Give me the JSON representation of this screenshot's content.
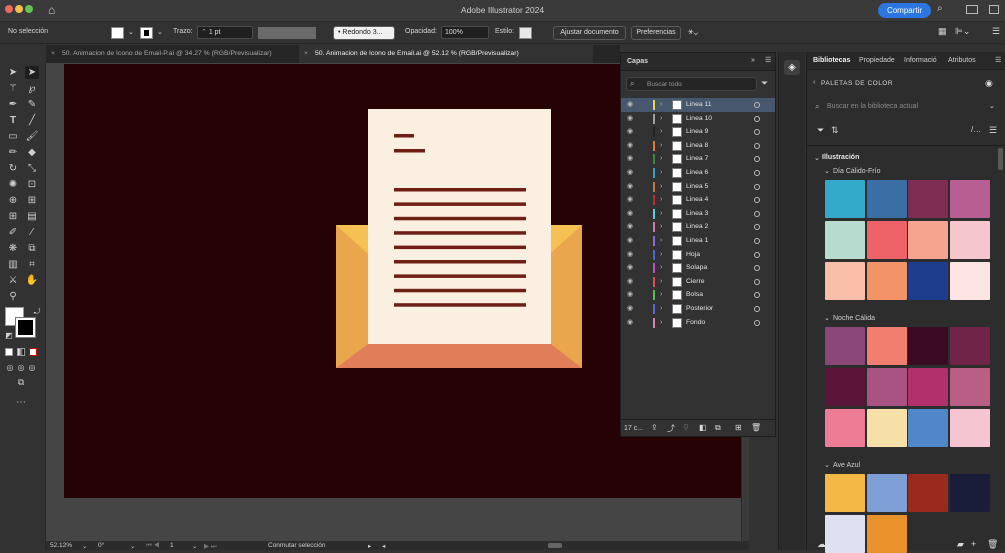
{
  "app": {
    "title": "Adobe Illustrator 2024",
    "share_label": "Compartir"
  },
  "control_bar": {
    "selection": "No selección",
    "stroke_label": "Trazo:",
    "stroke_value": "1 pt",
    "brush_value": "Redondo 3...",
    "opacity_label": "Opacidad:",
    "opacity_value": "100%",
    "style_label": "Estilo:",
    "fit_doc_label": "Ajustar documento",
    "prefs_label": "Preferencias"
  },
  "tabs": [
    {
      "label": "50. Animacion de Icono de Email-P.ai @ 34.27 % (RGB/Previsualizar)",
      "active": false
    },
    {
      "label": "50. Animacion de Icono de Email.ai @ 52.12 % (RGB/Previsualizar)",
      "active": true
    }
  ],
  "status": {
    "zoom": "52.12%",
    "rotation": "0°",
    "artboard": "1",
    "mode": "Conmutar selección"
  },
  "layers_panel": {
    "title": "Capas",
    "search_placeholder": "Buscar todo",
    "count_label": "17 c...",
    "layers": [
      {
        "name": "Linea 11",
        "color": "#e8d44a",
        "selected": true
      },
      {
        "name": "Linea 10",
        "color": "#a0a0a0",
        "selected": false
      },
      {
        "name": "Linea 9",
        "color": "#222222",
        "selected": false
      },
      {
        "name": "Linea 8",
        "color": "#e07a2c",
        "selected": false
      },
      {
        "name": "Linea 7",
        "color": "#3c8a3c",
        "selected": false
      },
      {
        "name": "Linea 6",
        "color": "#3ba0c8",
        "selected": false
      },
      {
        "name": "Linea 5",
        "color": "#c07a4a",
        "selected": false
      },
      {
        "name": "Linea 4",
        "color": "#b83030",
        "selected": false
      },
      {
        "name": "Linea 3",
        "color": "#5ad0e0",
        "selected": false
      },
      {
        "name": "Linea 2",
        "color": "#d878b0",
        "selected": false
      },
      {
        "name": "Linea 1",
        "color": "#8a6ad8",
        "selected": false
      },
      {
        "name": "Hoja",
        "color": "#4a6ad8",
        "selected": false
      },
      {
        "name": "Solapa",
        "color": "#c050c0",
        "selected": false
      },
      {
        "name": "Cierre",
        "color": "#e05050",
        "selected": false
      },
      {
        "name": "Bolsa",
        "color": "#50c050",
        "selected": false
      },
      {
        "name": "Posterior",
        "color": "#5a6ad8",
        "selected": false
      },
      {
        "name": "Fondo",
        "color": "#d880b0",
        "selected": false
      }
    ]
  },
  "libraries": {
    "tabs": [
      "Bibliotecas",
      "Propiedade",
      "Informació",
      "Atributos"
    ],
    "breadcrumb": "PALETAS DE COLOR",
    "search_placeholder": "Buscar en la biblioteca actual",
    "section": "Illustración",
    "groups": [
      {
        "name": "Día Cálido-Frío",
        "colors": [
          "#34aacb",
          "#3b6ea5",
          "#7f2d53",
          "#b75f92",
          "#b8dbd0",
          "#ec6266",
          "#f5a48f",
          "#f6c6cf",
          "#f8bea8",
          "#f29468",
          "#1c3d8c",
          "#fbe4e2"
        ]
      },
      {
        "name": "Noche Cálida",
        "colors": [
          "#8a4777",
          "#f17f6f",
          "#3b0a23",
          "#6f2448",
          "#5a1438",
          "#a85384",
          "#b2316a",
          "#b95e85",
          "#ed7b93",
          "#f6e0a8",
          "#4f87c9",
          "#f6c5d2"
        ]
      },
      {
        "name": "Ave Azul",
        "colors": [
          "#f4b847",
          "#7d9fd6",
          "#9b2a1e",
          "#1a1d3a",
          "#dfe1f2",
          "#e9922c"
        ]
      }
    ]
  },
  "artwork": {
    "paper_color": "#fbefe1",
    "line_color": "#6e1e12",
    "envelope_back": "#eaa64c",
    "envelope_flap": "#f5c153",
    "envelope_front": "#e07e5a"
  }
}
